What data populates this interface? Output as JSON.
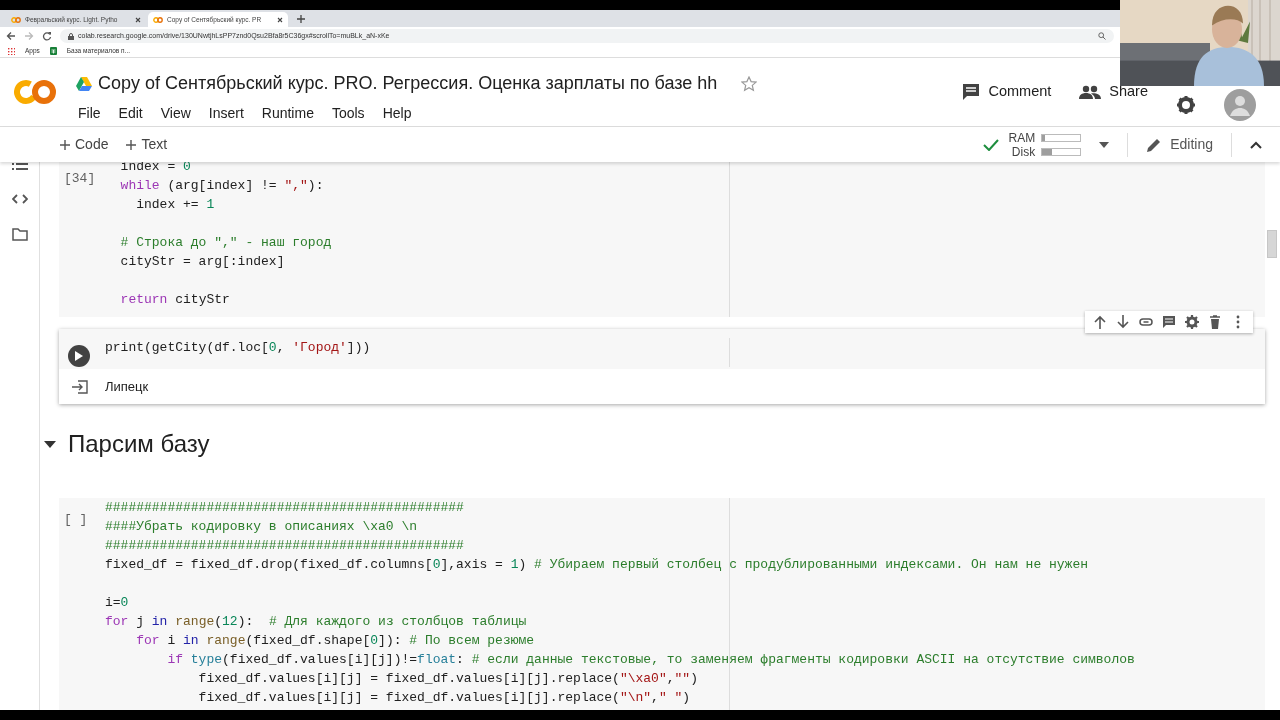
{
  "browser": {
    "tabs": [
      {
        "title": "Февральский курс. Light. Pytho",
        "selected": false
      },
      {
        "title": "Copy of Сентябрьский курс. PR",
        "selected": true
      }
    ],
    "url": "colab.research.google.com/drive/130UNwtjhLsPP7znd0Qsu2Bfa8r5C36gx#scrollTo=muBLk_aN-xKe",
    "bookmarks": [
      {
        "kind": "apps",
        "label": "Apps"
      },
      {
        "kind": "sheet",
        "label": "База материалов п..."
      }
    ]
  },
  "notebook": {
    "title": "Copy of Сентябрьский курс. PRO. Регрессия. Оценка зарплаты по базе hh",
    "starred": false,
    "menu": [
      "File",
      "Edit",
      "View",
      "Insert",
      "Runtime",
      "Tools",
      "Help"
    ],
    "actions": [
      {
        "kind": "comment",
        "label": "Comment"
      },
      {
        "kind": "share",
        "label": "Share"
      }
    ]
  },
  "toolbar": {
    "add_buttons": [
      "Code",
      "Text"
    ],
    "connected": true,
    "resources": [
      {
        "label": "RAM",
        "level": 0.08
      },
      {
        "label": "Disk",
        "level": 0.25
      }
    ],
    "mode": "Editing"
  },
  "cells": [
    {
      "kind": "code",
      "selected": false,
      "exec_label": "[34]",
      "lines": [
        {
          "kind": "code",
          "segments": [
            {
              "kind": "plain",
              "text": "  index = "
            },
            {
              "kind": "number",
              "text": "0"
            }
          ]
        },
        {
          "kind": "code",
          "segments": [
            {
              "kind": "keyword",
              "text": "  while"
            },
            {
              "kind": "plain",
              "text": " (arg[index] != "
            },
            {
              "kind": "string",
              "text": "\",\""
            },
            {
              "kind": "plain",
              "text": "):"
            }
          ]
        },
        {
          "kind": "code",
          "segments": [
            {
              "kind": "plain",
              "text": "    index += "
            },
            {
              "kind": "number",
              "text": "1"
            }
          ]
        },
        {
          "kind": "blank"
        },
        {
          "kind": "code",
          "segments": [
            {
              "kind": "comment",
              "text": "  # Строка до \",\" - наш город"
            }
          ]
        },
        {
          "kind": "code",
          "segments": [
            {
              "kind": "plain",
              "text": "  cityStr = arg[:index]"
            }
          ]
        },
        {
          "kind": "blank"
        },
        {
          "kind": "code",
          "segments": [
            {
              "kind": "keyword",
              "text": "  return"
            },
            {
              "kind": "plain",
              "text": " cityStr"
            }
          ]
        }
      ]
    },
    {
      "kind": "code",
      "selected": true,
      "lines": [
        {
          "kind": "code",
          "segments": [
            {
              "kind": "plain",
              "text": "print(getCity(df.loc["
            },
            {
              "kind": "number",
              "text": "0"
            },
            {
              "kind": "plain",
              "text": ", "
            },
            {
              "kind": "string",
              "text": "'Город'"
            },
            {
              "kind": "plain",
              "text": "]))"
            }
          ]
        }
      ],
      "output": "Липецк"
    },
    {
      "kind": "heading",
      "selected": false,
      "text": "Парсим базу",
      "expanded": true
    },
    {
      "kind": "code",
      "selected": false,
      "exec_label": "[ ]",
      "lines": [
        {
          "kind": "code",
          "segments": [
            {
              "kind": "comment",
              "text": "##############################################"
            }
          ]
        },
        {
          "kind": "code",
          "segments": [
            {
              "kind": "comment",
              "text": "####Убрать кодировку в описаниях \\xa0 \\n"
            }
          ]
        },
        {
          "kind": "code",
          "segments": [
            {
              "kind": "comment",
              "text": "##############################################"
            }
          ]
        },
        {
          "kind": "code",
          "segments": [
            {
              "kind": "plain",
              "text": "fixed_df = fixed_df.drop(fixed_df.columns["
            },
            {
              "kind": "number",
              "text": "0"
            },
            {
              "kind": "plain",
              "text": "],axis = "
            },
            {
              "kind": "number",
              "text": "1"
            },
            {
              "kind": "plain",
              "text": ") "
            },
            {
              "kind": "comment",
              "text": "# Убираем первый столбец с продублированными индексами. Он нам не нужен"
            }
          ]
        },
        {
          "kind": "blank"
        },
        {
          "kind": "code",
          "segments": [
            {
              "kind": "plain",
              "text": "i="
            },
            {
              "kind": "number",
              "text": "0"
            }
          ]
        },
        {
          "kind": "code",
          "segments": [
            {
              "kind": "keyword",
              "text": "for"
            },
            {
              "kind": "plain",
              "text": " j "
            },
            {
              "kind": "operator_word",
              "text": "in"
            },
            {
              "kind": "builtin",
              "text": " range"
            },
            {
              "kind": "plain",
              "text": "("
            },
            {
              "kind": "number",
              "text": "12"
            },
            {
              "kind": "plain",
              "text": "):  "
            },
            {
              "kind": "comment",
              "text": "# Для каждого из столбцов таблицы"
            }
          ]
        },
        {
          "kind": "code",
          "segments": [
            {
              "kind": "keyword",
              "text": "    for"
            },
            {
              "kind": "plain",
              "text": " i "
            },
            {
              "kind": "operator_word",
              "text": "in"
            },
            {
              "kind": "builtin",
              "text": " range"
            },
            {
              "kind": "plain",
              "text": "(fixed_df.shape["
            },
            {
              "kind": "number",
              "text": "0"
            },
            {
              "kind": "plain",
              "text": "]): "
            },
            {
              "kind": "comment",
              "text": "# По всем резюме"
            }
          ]
        },
        {
          "kind": "code",
          "segments": [
            {
              "kind": "keyword",
              "text": "        if"
            },
            {
              "kind": "type",
              "text": " type"
            },
            {
              "kind": "plain",
              "text": "(fixed_df.values[i][j])!="
            },
            {
              "kind": "type",
              "text": "float"
            },
            {
              "kind": "plain",
              "text": ": "
            },
            {
              "kind": "comment",
              "text": "# если данные текстовые, то заменяем фрагменты кодировки ASCII на отсутствие символов"
            }
          ]
        },
        {
          "kind": "code",
          "segments": [
            {
              "kind": "plain",
              "text": "            fixed_df.values[i][j] = fixed_df.values[i][j].replace("
            },
            {
              "kind": "string",
              "text": "\"\\xa0\""
            },
            {
              "kind": "plain",
              "text": ","
            },
            {
              "kind": "string",
              "text": "\"\""
            },
            {
              "kind": "plain",
              "text": ")"
            }
          ]
        },
        {
          "kind": "code",
          "segments": [
            {
              "kind": "plain",
              "text": "            fixed_df.values[i][j] = fixed_df.values[i][j].replace("
            },
            {
              "kind": "string",
              "text": "\"\\n\""
            },
            {
              "kind": "plain",
              "text": ","
            },
            {
              "kind": "string",
              "text": "\" \""
            },
            {
              "kind": "plain",
              "text": ")"
            }
          ]
        }
      ]
    }
  ]
}
